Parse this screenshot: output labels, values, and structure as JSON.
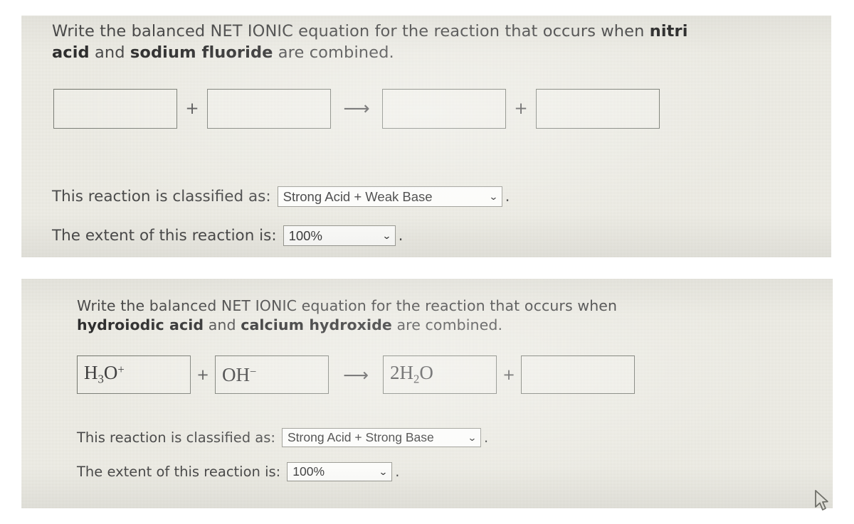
{
  "page": {
    "background": "#ffffff",
    "paper_color": "#e9e8de",
    "ink_color": "#4a4a4a",
    "box_border_color": "#777a72"
  },
  "problems": [
    {
      "id": "problem-1",
      "prompt_line_1_prefix": "Write the balanced NET IONIC equation for the reaction that occurs when ",
      "prompt_line_1_bold": "nitri",
      "prompt_line_2_bold_1": "acid",
      "prompt_line_2_mid": " and ",
      "prompt_line_2_bold_2": "sodium fluoride",
      "prompt_line_2_suffix": " are combined.",
      "equation": {
        "reactant_1": "",
        "plus_1": "+",
        "reactant_2": "",
        "arrow": "⟶",
        "product_1": "",
        "plus_2": "+",
        "product_2": ""
      },
      "classification": {
        "label": "This reaction is classified as:",
        "value": "Strong Acid + Weak Base",
        "caret": "⌄",
        "tail": "."
      },
      "extent": {
        "label": "The extent of this reaction is:",
        "value": "100%",
        "caret": "⌄",
        "tail": "."
      }
    },
    {
      "id": "problem-2",
      "prompt_line_1": "Write the balanced NET IONIC equation for the reaction that occurs when",
      "prompt_line_2_bold_1": "hydroiodic acid",
      "prompt_line_2_mid": " and ",
      "prompt_line_2_bold_2": "calcium hydroxide",
      "prompt_line_2_suffix": " are combined.",
      "equation": {
        "reactant_1": "H3O+",
        "plus_1": "+",
        "reactant_2": "OH-",
        "arrow": "⟶",
        "product_1": "2H2O",
        "plus_2": "+",
        "product_2": ""
      },
      "classification": {
        "label": "This reaction is classified as:",
        "value": "Strong Acid + Strong Base",
        "caret": "⌄",
        "tail": "."
      },
      "extent": {
        "label": "The extent of this reaction is:",
        "value": "100%",
        "caret": "⌄",
        "tail": "."
      }
    }
  ],
  "cursor": {
    "icon": "mouse-pointer-icon"
  }
}
